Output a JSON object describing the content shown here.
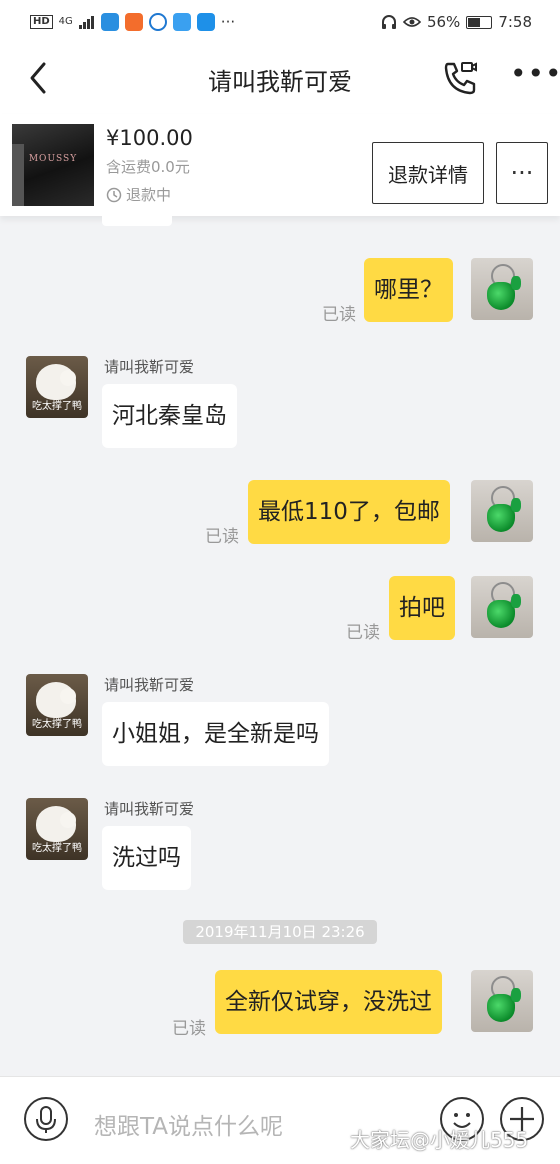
{
  "status_bar": {
    "network": "4G",
    "battery_percent": "56%",
    "battery_level": 0.56,
    "time": "7:58",
    "overflow": "···"
  },
  "nav": {
    "title": "请叫我靳可爱",
    "more": "•••"
  },
  "product": {
    "image_text": "MOUSSY",
    "price": "¥100.00",
    "shipping": "含运费0.0元",
    "status": "退款中",
    "refund_button": "退款详情",
    "more_button": "···"
  },
  "messages": [
    {
      "side": "out",
      "text": "哪里？",
      "read": "已读"
    },
    {
      "side": "in",
      "sender": "请叫我靳可爱",
      "text": "河北秦皇岛",
      "avatar_caption": "吃太撑了鸭"
    },
    {
      "side": "out",
      "text": "最低110了，包邮",
      "read": "已读"
    },
    {
      "side": "out",
      "text": "拍吧",
      "read": "已读"
    },
    {
      "side": "in",
      "sender": "请叫我靳可爱",
      "text": "小姐姐，是全新是吗",
      "avatar_caption": "吃太撑了鸭"
    },
    {
      "side": "in",
      "sender": "请叫我靳可爱",
      "text": "洗过吗",
      "avatar_caption": "吃太撑了鸭"
    },
    {
      "side": "out",
      "text": "全新仅试穿，没洗过",
      "read": "已读"
    }
  ],
  "timestamp": "2019年11月10日 23:26",
  "input": {
    "placeholder": "想跟TA说点什么呢"
  },
  "watermark": "大家坛@小媛儿555",
  "colors": {
    "bubble_out": "#ffda44",
    "bubble_in": "#ffffff",
    "chat_background": "#f2f3f5"
  }
}
